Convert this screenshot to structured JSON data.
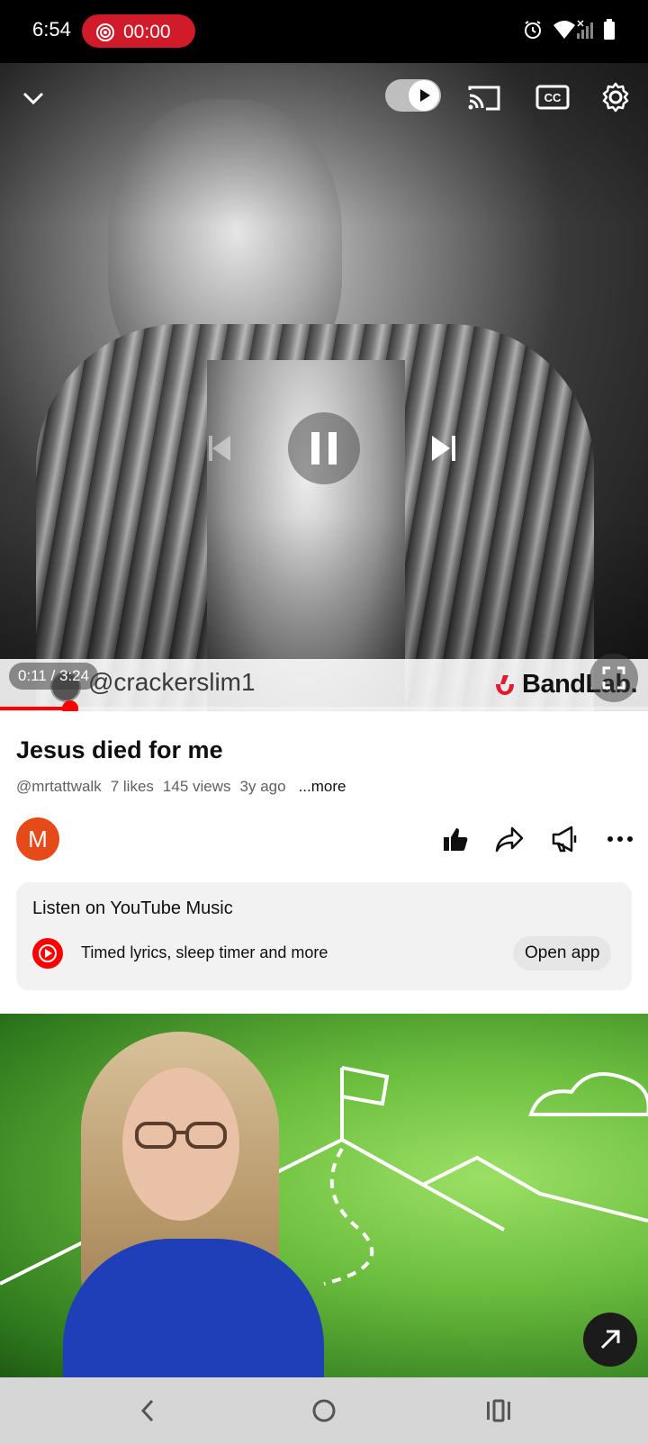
{
  "status_bar": {
    "time": "6:54",
    "recording_time": "00:00",
    "icons": [
      "screen-record-icon",
      "alarm-icon",
      "wifi-icon",
      "signal-icon",
      "battery-icon"
    ]
  },
  "player": {
    "current_time": "0:11",
    "duration": "3:24",
    "time_display": "0:11 / 3:24",
    "progress_fraction": 0.054,
    "watermark_handle": "@crackerslim1",
    "watermark_brand": "BandLab.",
    "controls": [
      "collapse-icon",
      "autoplay-toggle",
      "cast-icon",
      "captions-icon",
      "settings-icon",
      "previous-icon",
      "pause-icon",
      "next-icon",
      "fullscreen-icon"
    ],
    "accent_color": "#ff0000"
  },
  "video": {
    "title": "Jesus died for me",
    "channel": "@mrtattwalk",
    "likes": "7 likes",
    "views": "145 views",
    "age": "3y ago",
    "more": "...more",
    "channel_initial": "M",
    "avatar_color": "#e64a19"
  },
  "actions": [
    "like-icon",
    "share-icon",
    "promote-icon",
    "more-options-icon"
  ],
  "yt_music_card": {
    "title": "Listen on YouTube Music",
    "subtitle": "Timed lyrics, sleep timer and more",
    "button": "Open app"
  },
  "navbar": [
    "back-icon",
    "home-icon",
    "recents-icon"
  ]
}
